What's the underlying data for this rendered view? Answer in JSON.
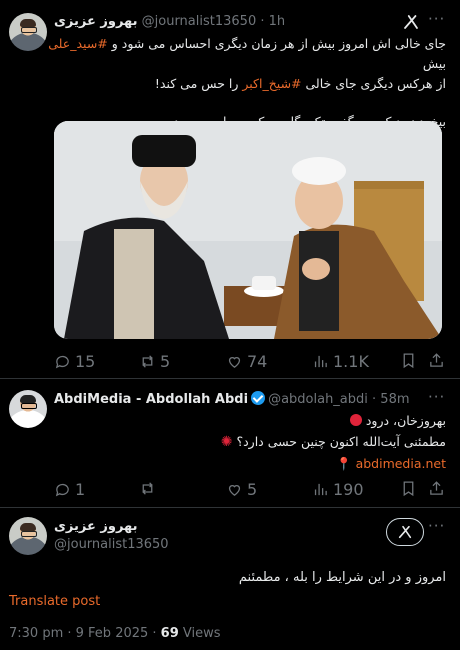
{
  "tweet1": {
    "name": "بهروز عزیزی",
    "handle": "@journalist13650",
    "time": "· 1h",
    "line1_pre": "جای خالی اش امروز بیش از هر زمان دیگری احساس می شود و ",
    "line1_tag": "#سید_علی",
    "line1_post": " بیش",
    "line2_pre": "از هرکس دیگری جای خالی ",
    "line2_tag": "#شیخ_اکبر",
    "line2_post": " را حس می کند!",
    "line3": "بیخود نبود که می گفت تکیه گاه محکمی برای من بود",
    "stats": {
      "replies": "15",
      "reposts": "5",
      "likes": "74",
      "views": "1.1K"
    }
  },
  "tweet2": {
    "name": "AbdiMedia - Abdollah Abdi",
    "handle": "@abdolah_abdi",
    "time": "· 58m",
    "line1": "بهروزخان، درود",
    "line2": "مطمئنی آیت‌الله اکنون چنین حسی دارد؟",
    "link": "abdimedia.net",
    "stats": {
      "replies": "1",
      "reposts": "",
      "likes": "5",
      "views": "190"
    }
  },
  "tweet3": {
    "name": "بهروز عزیزی",
    "handle": "@journalist13650",
    "body": "امروز و در این شرایط را بله ، مطمئنم",
    "translate": "Translate post",
    "time": "7:30 pm · 9 Feb 2025 · ",
    "views_count": "69",
    "views_label": " Views"
  },
  "icons": {
    "more": "more-dots-icon",
    "grok": "grok-icon",
    "reply": "reply-icon",
    "repost": "repost-icon",
    "like": "like-icon",
    "views": "views-icon",
    "bookmark": "bookmark-icon",
    "share": "share-icon"
  },
  "colors": {
    "background": "#000000",
    "text": "#e7e9ea",
    "muted": "#71767b",
    "hashtag": "#e96a2b",
    "verified": "#1d9bf0"
  }
}
